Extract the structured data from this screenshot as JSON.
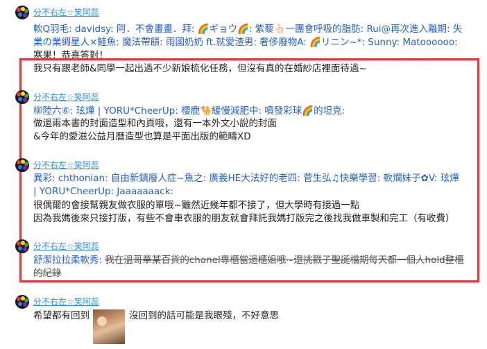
{
  "author_name": "分不右左☆笑阿蕊",
  "post1": {
    "lines": [
      "軟Q羽毛: davidsy: 阿．不會畫畫．拜: 🌈ギョウ🌈: 紫藜👆🏻一團會呼吸的脂肪: Rui@再次進入離期: 失",
      "業の業綢星人×鮭魚: 魔法帶饋: 雨國奶奶 ft.就愛渣男: 奢侈廢物A: 🌈リニン~*: Sunny: Matoooooo:",
      "寒果！恭喜答對！"
    ]
  },
  "highlighted_text": "我只有跟老師&同學一起出過不少新娘梳化任務，但沒有真的在婚紗店裡面待過~",
  "post2": {
    "mention_line": "柳陸六⑥: 玹燁 | YORU*CheerUp: 櫻鹿🐪緩慢減肥中: 噴發彩球🌈的坦克:",
    "text_lines": [
      "做過兩本書的封面造型和內頁哦，還有一本外文小說的封面",
      "&今年的愛滋公益月曆造型也算是平面出版的範疇XD"
    ]
  },
  "post3": {
    "mention_lines": [
      "異彩: chthonian: 自由新鎮廢人症~魚之: 廣義HE大法好的老四: 菅生弘♫快樂學習: 軟爛妹子✿V: 玹燁",
      "| YORU*CheerUp: Jaaaaaaack:"
    ],
    "text_lines": [
      "很偶爾的會接幫親友做衣服的單哦~雖然近幾年都不接了，但大學時有接過一點",
      "因為我媽後來只接打版，有些不會車衣服的朋友就會拜託我媽打版完之後找我做車製和完工（有收費）"
    ]
  },
  "post4": {
    "mention": "舒潔拉拉柔軟秀:",
    "line1_text": "我在溫哥華某百貨的chanel專櫃當過櫃姐哦~還挑戳子聖誕檔期每天都一個人hold整櫃",
    "line2_text": "的紀錄"
  },
  "post5": {
    "text_before_image": "希望都有回到",
    "text_after_image": "沒回到的話可能是我眼殘，不好意思"
  },
  "colors": {
    "author": "#2a8fd8",
    "mention": "#2561c8",
    "highlight_border": "#e53935"
  }
}
